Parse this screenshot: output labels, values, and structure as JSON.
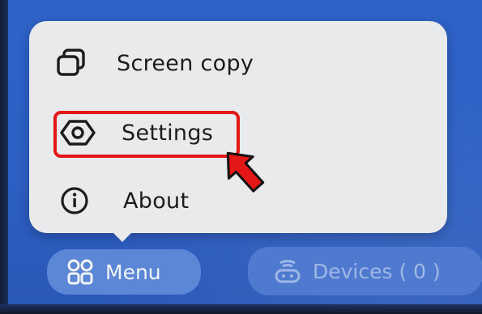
{
  "popup_menu": {
    "items": [
      {
        "label": "Screen copy",
        "icon": "screen-copy-icon"
      },
      {
        "label": "Settings",
        "icon": "settings-hexagon-icon"
      },
      {
        "label": "About",
        "icon": "info-icon"
      }
    ]
  },
  "bottom_bar": {
    "menu_label": "Menu",
    "menu_icon": "grid-icon",
    "devices_label": "Devices ( 0 )",
    "devices_icon": "devices-icon"
  },
  "annotation": {
    "highlight_color": "#e51616",
    "arrow_color": "#e51616"
  },
  "colors": {
    "background": "#2f63c9",
    "popup": "#e9eaec",
    "text": "#1c1c1c"
  }
}
